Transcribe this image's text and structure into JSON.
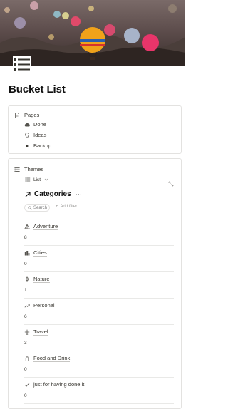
{
  "page": {
    "title": "Bucket List"
  },
  "pages_block": {
    "heading": "Pages",
    "items": [
      {
        "label": "Done",
        "icon": "cloud-icon"
      },
      {
        "label": "Ideas",
        "icon": "lightbulb-icon"
      },
      {
        "label": "Backup",
        "icon": "triangle-right-icon"
      }
    ]
  },
  "themes_block": {
    "heading": "Themes",
    "view_label": "List",
    "database_title": "Categories",
    "more": "···",
    "search_label": "Search",
    "add_filter_label": "Add filter",
    "items": [
      {
        "label": "Adventure",
        "count": "8",
        "icon": "tent-icon"
      },
      {
        "label": "Cities",
        "count": "0",
        "icon": "city-icon"
      },
      {
        "label": "Nature",
        "count": "1",
        "icon": "leaf-icon"
      },
      {
        "label": "Personal",
        "count": "6",
        "icon": "trend-icon"
      },
      {
        "label": "Travel",
        "count": "3",
        "icon": "plane-icon"
      },
      {
        "label": "Food and Drink",
        "count": "0",
        "icon": "bottle-icon"
      },
      {
        "label": "just for having done it",
        "count": "0",
        "icon": "check-icon"
      }
    ]
  },
  "colors": {
    "border": "#e3e2e0",
    "text": "#37352f",
    "muted": "#9b9a97"
  }
}
